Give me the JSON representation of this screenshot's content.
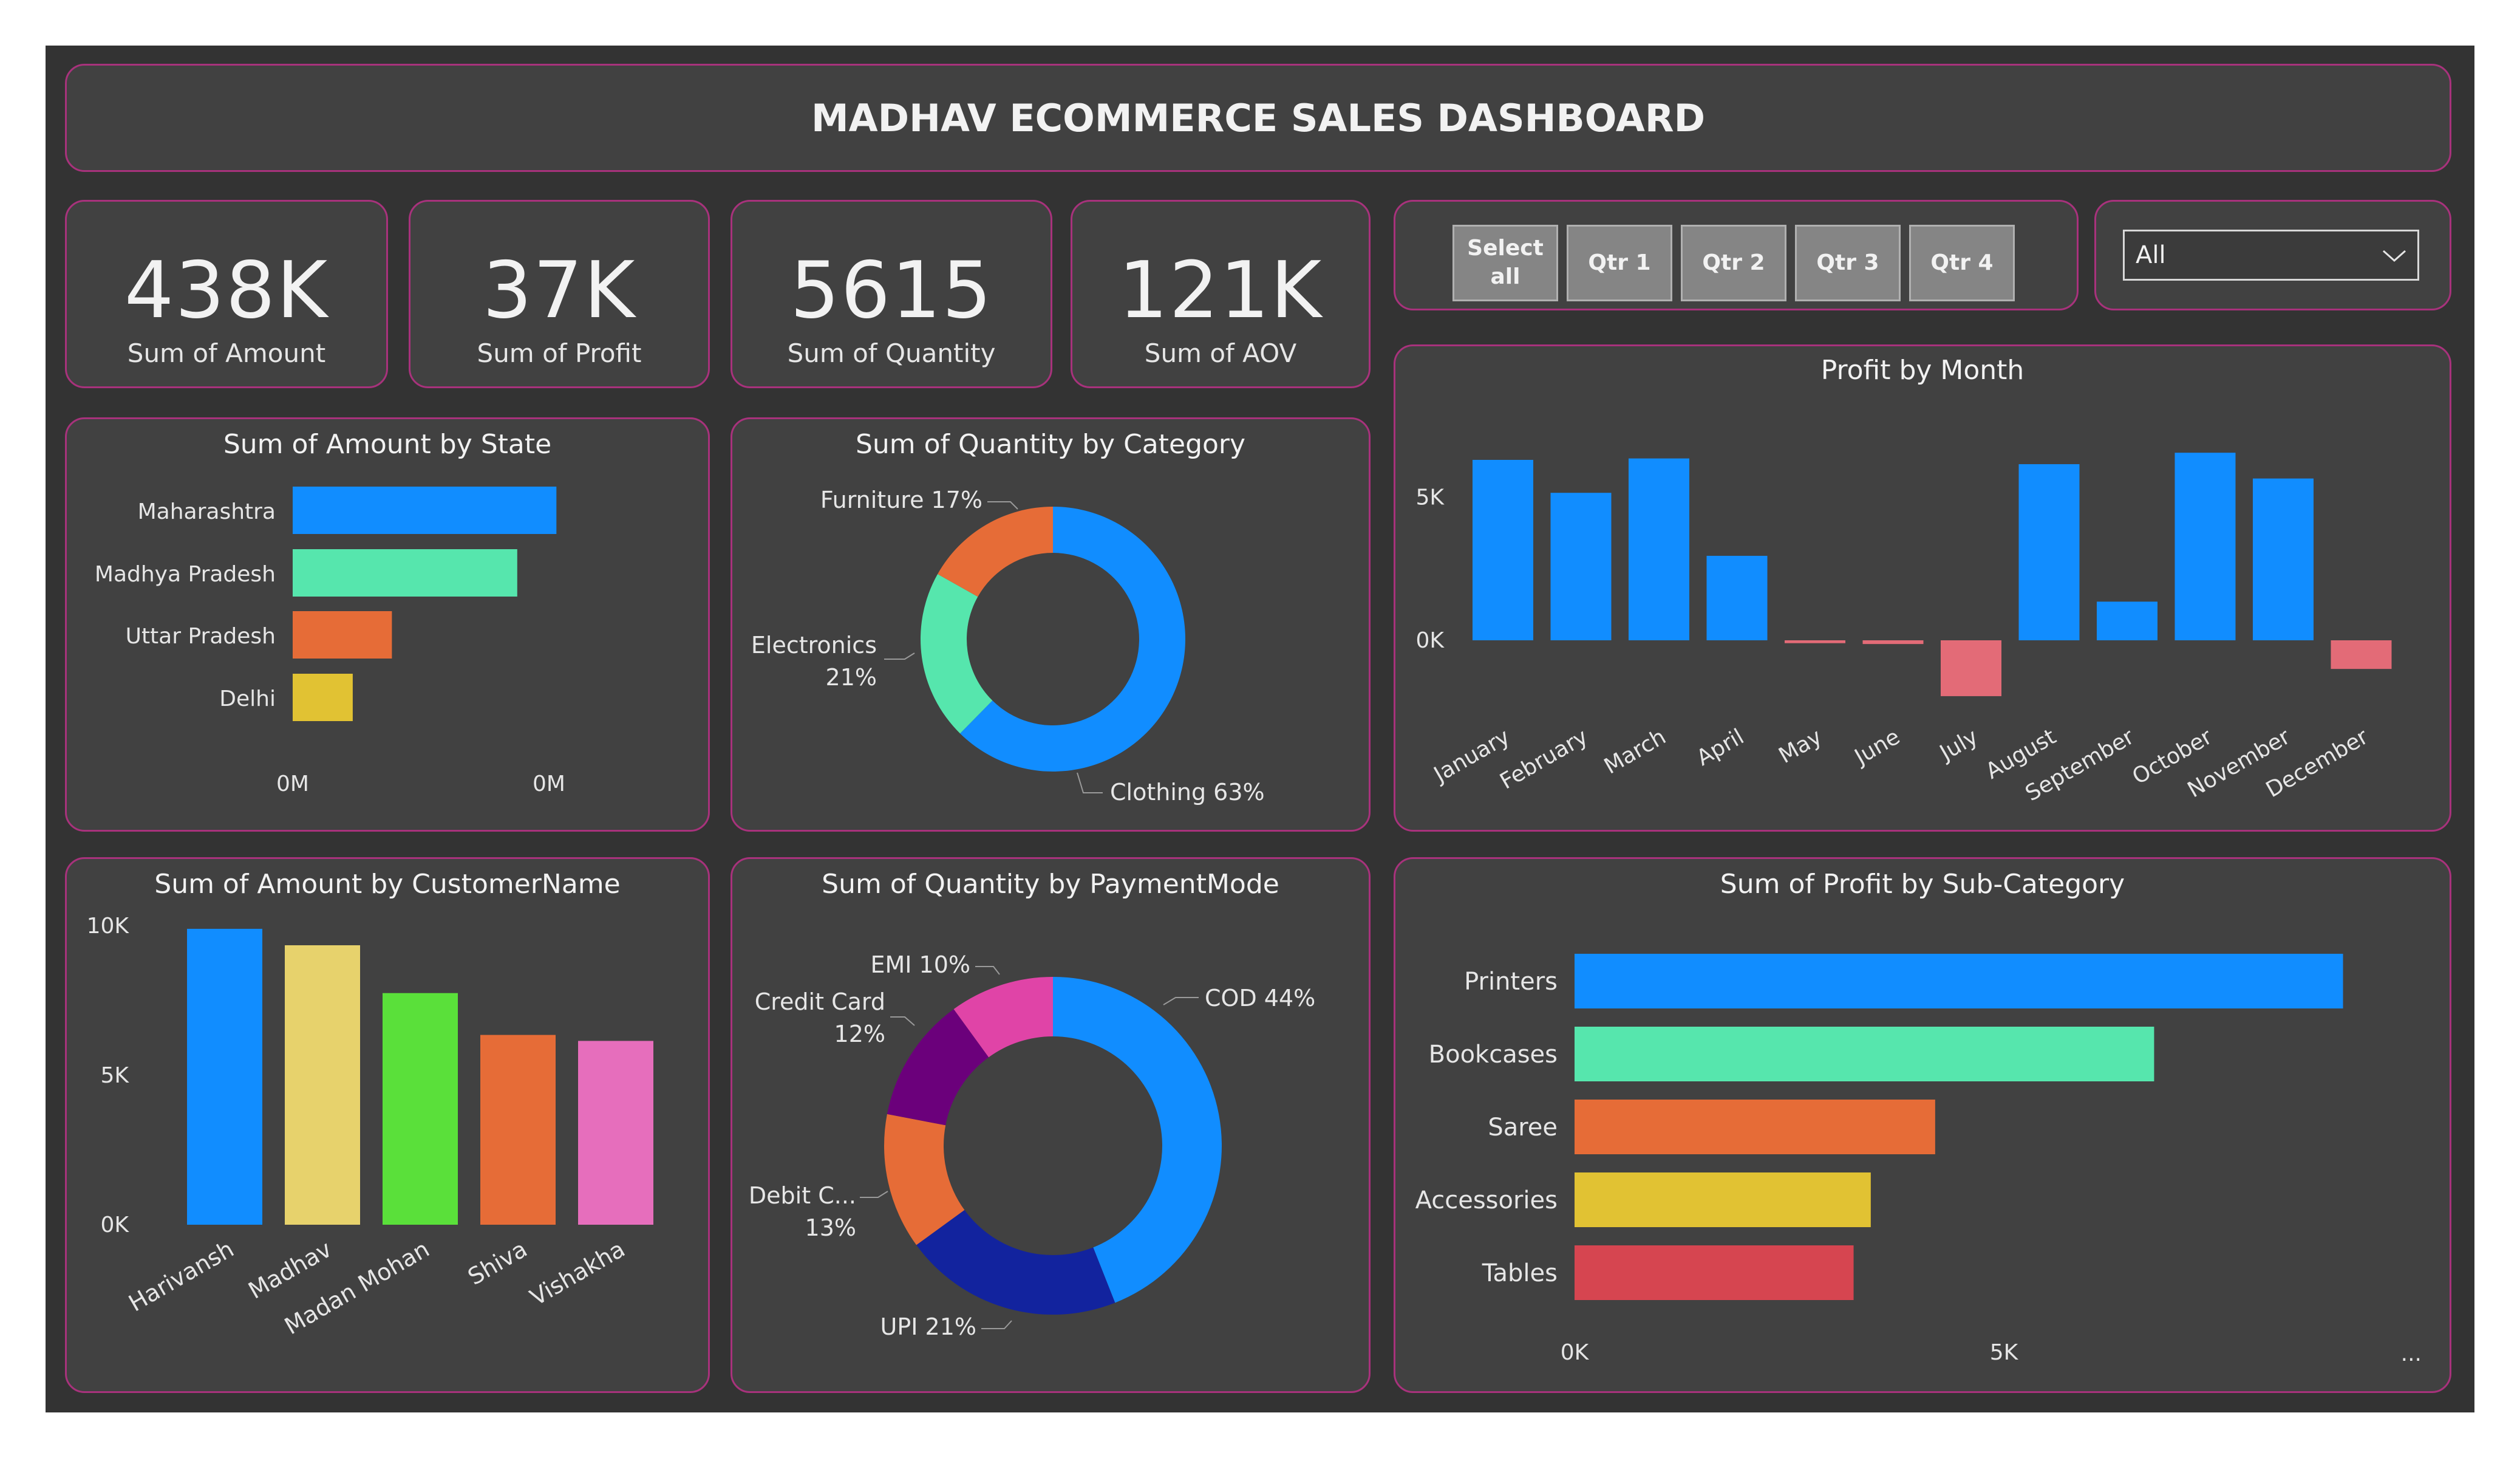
{
  "header": {
    "title": "MADHAV ECOMMERCE SALES DASHBOARD"
  },
  "kpis": [
    {
      "value": "438K",
      "label": "Sum of Amount"
    },
    {
      "value": "37K",
      "label": "Sum of Profit"
    },
    {
      "value": "5615",
      "label": "Sum of Quantity"
    },
    {
      "value": "121K",
      "label": "Sum of AOV"
    }
  ],
  "quarter_slicer": {
    "buttons": [
      {
        "label": "Select all"
      },
      {
        "label": "Qtr 1"
      },
      {
        "label": "Qtr 2"
      },
      {
        "label": "Qtr 3"
      },
      {
        "label": "Qtr 4"
      }
    ]
  },
  "dropdown": {
    "value": "All",
    "icon": "chevron-down-icon"
  },
  "colors": {
    "blue": "#118dff",
    "teal": "#56e6ad",
    "orange": "#e66c37",
    "yellow": "#e1c233",
    "navy": "#12239e",
    "purple": "#6b007b",
    "magenta": "#e044a7",
    "pink": "#e66ebc",
    "green": "#5ae03a",
    "khaki": "#e7d26c",
    "red": "#d64550",
    "salmon": "#e36b77",
    "border": "#a8327c"
  },
  "chart_data": [
    {
      "id": "state",
      "type": "bar",
      "orientation": "horizontal",
      "title": "Sum of Amount by State",
      "categories": [
        "Maharashtra",
        "Madhya Pradesh",
        "Uttar Pradesh",
        "Delhi"
      ],
      "values": [
        101,
        86,
        38,
        23
      ],
      "colors": [
        "#118dff",
        "#56e6ad",
        "#e66c37",
        "#e1c233"
      ],
      "x_tick_labels": [
        "0M",
        "0M"
      ]
    },
    {
      "id": "category",
      "type": "pie",
      "donut": true,
      "title": "Sum of Quantity by Category",
      "slices": [
        {
          "label": "Clothing",
          "value": 63
        },
        {
          "label": "Electronics",
          "value": 21
        },
        {
          "label": "Furniture",
          "value": 17
        }
      ],
      "data_labels": [
        {
          "text": "Furniture 17%"
        },
        {
          "text": "Electronics"
        },
        {
          "text": "21%"
        },
        {
          "text": "Clothing 63%"
        }
      ],
      "colors": [
        "#118dff",
        "#56e6ad",
        "#e66c37"
      ]
    },
    {
      "id": "month",
      "type": "bar",
      "title": "Profit by Month",
      "categories": [
        "January",
        "February",
        "March",
        "April",
        "May",
        "June",
        "July",
        "August",
        "September",
        "October",
        "November",
        "December"
      ],
      "values": [
        6300,
        5150,
        6350,
        2950,
        -100,
        -130,
        -1950,
        6150,
        1350,
        6550,
        5650,
        -1000
      ],
      "ylim": [
        -2000,
        8000
      ],
      "y_ticks": [
        {
          "value": 0,
          "label": "0K"
        },
        {
          "value": 5000,
          "label": "5K"
        }
      ],
      "positive_color": "#118dff",
      "negative_color": "#e36b77"
    },
    {
      "id": "customer",
      "type": "bar",
      "title": "Sum of Amount by CustomerName",
      "categories": [
        "Harivansh",
        "Madhav",
        "Madan Mohan",
        "Shiva",
        "Vishakha"
      ],
      "values": [
        9900,
        9350,
        7750,
        6350,
        6150
      ],
      "ylim": [
        0,
        10000
      ],
      "y_ticks": [
        {
          "value": 0,
          "label": "0K"
        },
        {
          "value": 5000,
          "label": "5K"
        },
        {
          "value": 10000,
          "label": "10K"
        }
      ],
      "colors": [
        "#118dff",
        "#e7d26c",
        "#5ae03a",
        "#e66c37",
        "#e66ebc"
      ]
    },
    {
      "id": "payment",
      "type": "pie",
      "donut": true,
      "title": "Sum of Quantity by PaymentMode",
      "slices": [
        {
          "label": "COD",
          "value": 44
        },
        {
          "label": "UPI",
          "value": 21
        },
        {
          "label": "Debit C...",
          "value": 13
        },
        {
          "label": "Credit Card",
          "value": 12
        },
        {
          "label": "EMI",
          "value": 10
        }
      ],
      "data_labels": [
        {
          "text": "COD 44%"
        },
        {
          "text": "UPI 21%"
        },
        {
          "text": "Debit C..."
        },
        {
          "text": "13%"
        },
        {
          "text": "Credit Card"
        },
        {
          "text": "12%"
        },
        {
          "text": "EMI 10%"
        }
      ],
      "colors": [
        "#118dff",
        "#12239e",
        "#e66c37",
        "#6b007b",
        "#e044a7"
      ]
    },
    {
      "id": "subcategory",
      "type": "bar",
      "orientation": "horizontal",
      "title": "Sum of Profit by Sub-Category",
      "categories": [
        "Printers",
        "Bookcases",
        "Saree",
        "Accessories",
        "Tables"
      ],
      "values": [
        8950,
        6750,
        4200,
        3450,
        3250
      ],
      "xlim": [
        0,
        10000
      ],
      "x_ticks": [
        {
          "value": 0,
          "label": "0K"
        },
        {
          "value": 5000,
          "label": "5K"
        }
      ],
      "more_label": "...",
      "colors": [
        "#118dff",
        "#56e6ad",
        "#e66c37",
        "#e1c233",
        "#d64550"
      ]
    }
  ]
}
